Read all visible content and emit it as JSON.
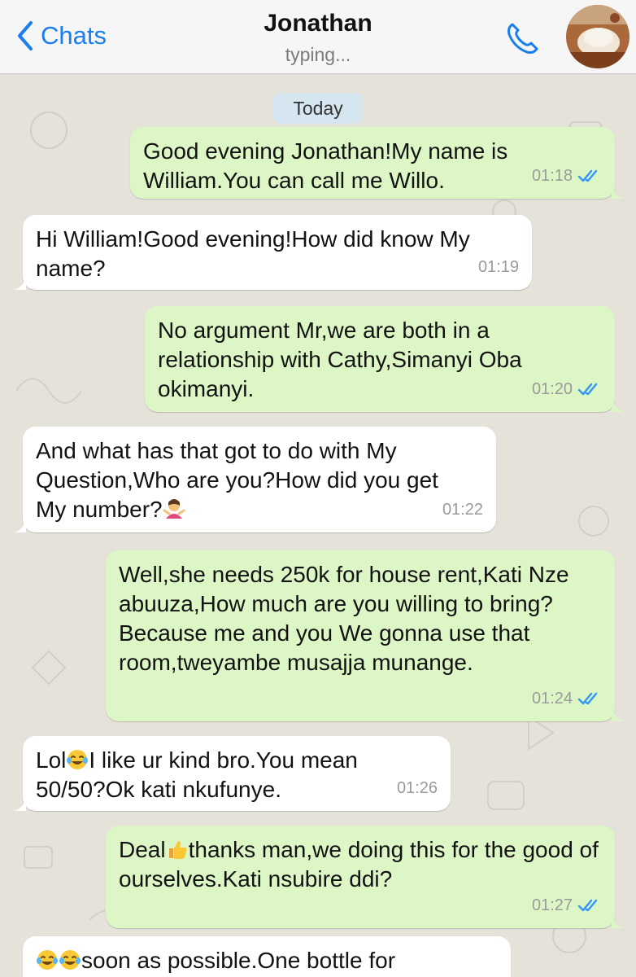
{
  "header": {
    "back_label": "Chats",
    "contact_name": "Jonathan",
    "contact_status": "typing..."
  },
  "date_divider": "Today",
  "messages": [
    {
      "direction": "outgoing",
      "text": "Good evening Jonathan!My name is William.You can call me Willo.",
      "time": "01:18",
      "read": true
    },
    {
      "direction": "incoming",
      "text": "Hi William!Good evening!How did know My name?",
      "time": "01:19"
    },
    {
      "direction": "outgoing",
      "text": "No argument Mr,we are both in a relationship with Cathy,Simanyi Oba okimanyi.",
      "time": "01:20",
      "read": true
    },
    {
      "direction": "incoming",
      "text_before_emoji": "And what has that got to do with My Question,Who are you?How did you get My number?",
      "emoji": "person-shrugging-emoji",
      "time": "01:22"
    },
    {
      "direction": "outgoing",
      "text": "Well,she needs 250k for house rent,Kati Nze abuuza,How much are you willing to bring?Because  me and you We gonna use that room,tweyambe musajja munange.",
      "time": "01:24",
      "read": true
    },
    {
      "direction": "incoming",
      "text_before_emoji": "Lol",
      "emoji": "tears-of-joy-emoji",
      "text_after_emoji": "I like ur kind bro.You mean 50/50?Ok kati nkufunye.",
      "time": "01:26"
    },
    {
      "direction": "outgoing",
      "text_before_emoji": "Deal",
      "emoji": "thumbs-up-emoji",
      "text_after_emoji": "thanks man,we doing this for the good of ourselves.Kati nsubire ddi?",
      "time": "01:27",
      "read": true
    },
    {
      "direction": "incoming",
      "emoji": "tears-of-joy-emoji",
      "text_after_emoji": "soon as possible.One bottle for"
    }
  ],
  "colors": {
    "accent": "#1a7df0",
    "outgoing_bubble": "#dcf7c5",
    "incoming_bubble": "#ffffff",
    "wallpaper": "#e5e2da",
    "read_ticks": "#3497f9"
  }
}
